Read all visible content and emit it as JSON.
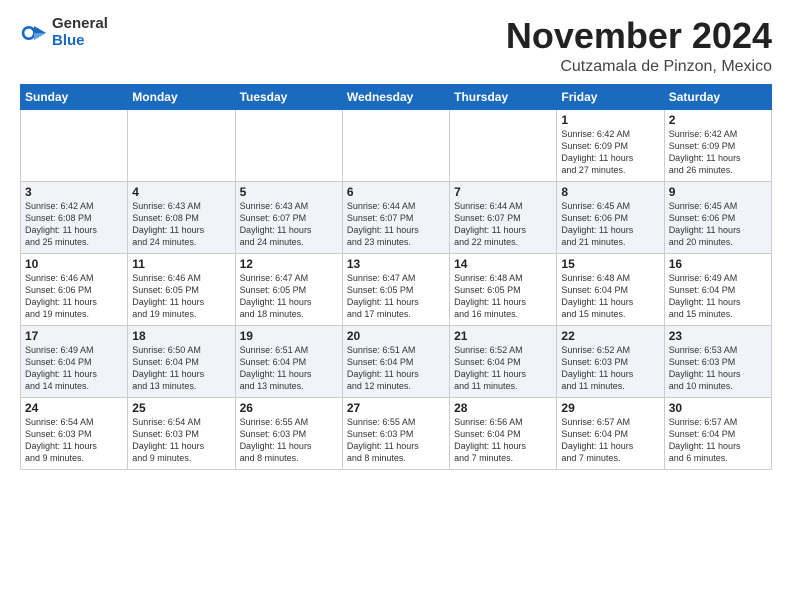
{
  "logo": {
    "general": "General",
    "blue": "Blue"
  },
  "title": "November 2024",
  "location": "Cutzamala de Pinzon, Mexico",
  "headers": [
    "Sunday",
    "Monday",
    "Tuesday",
    "Wednesday",
    "Thursday",
    "Friday",
    "Saturday"
  ],
  "weeks": [
    [
      {
        "day": "",
        "info": ""
      },
      {
        "day": "",
        "info": ""
      },
      {
        "day": "",
        "info": ""
      },
      {
        "day": "",
        "info": ""
      },
      {
        "day": "",
        "info": ""
      },
      {
        "day": "1",
        "info": "Sunrise: 6:42 AM\nSunset: 6:09 PM\nDaylight: 11 hours\nand 27 minutes."
      },
      {
        "day": "2",
        "info": "Sunrise: 6:42 AM\nSunset: 6:09 PM\nDaylight: 11 hours\nand 26 minutes."
      }
    ],
    [
      {
        "day": "3",
        "info": "Sunrise: 6:42 AM\nSunset: 6:08 PM\nDaylight: 11 hours\nand 25 minutes."
      },
      {
        "day": "4",
        "info": "Sunrise: 6:43 AM\nSunset: 6:08 PM\nDaylight: 11 hours\nand 24 minutes."
      },
      {
        "day": "5",
        "info": "Sunrise: 6:43 AM\nSunset: 6:07 PM\nDaylight: 11 hours\nand 24 minutes."
      },
      {
        "day": "6",
        "info": "Sunrise: 6:44 AM\nSunset: 6:07 PM\nDaylight: 11 hours\nand 23 minutes."
      },
      {
        "day": "7",
        "info": "Sunrise: 6:44 AM\nSunset: 6:07 PM\nDaylight: 11 hours\nand 22 minutes."
      },
      {
        "day": "8",
        "info": "Sunrise: 6:45 AM\nSunset: 6:06 PM\nDaylight: 11 hours\nand 21 minutes."
      },
      {
        "day": "9",
        "info": "Sunrise: 6:45 AM\nSunset: 6:06 PM\nDaylight: 11 hours\nand 20 minutes."
      }
    ],
    [
      {
        "day": "10",
        "info": "Sunrise: 6:46 AM\nSunset: 6:06 PM\nDaylight: 11 hours\nand 19 minutes."
      },
      {
        "day": "11",
        "info": "Sunrise: 6:46 AM\nSunset: 6:05 PM\nDaylight: 11 hours\nand 19 minutes."
      },
      {
        "day": "12",
        "info": "Sunrise: 6:47 AM\nSunset: 6:05 PM\nDaylight: 11 hours\nand 18 minutes."
      },
      {
        "day": "13",
        "info": "Sunrise: 6:47 AM\nSunset: 6:05 PM\nDaylight: 11 hours\nand 17 minutes."
      },
      {
        "day": "14",
        "info": "Sunrise: 6:48 AM\nSunset: 6:05 PM\nDaylight: 11 hours\nand 16 minutes."
      },
      {
        "day": "15",
        "info": "Sunrise: 6:48 AM\nSunset: 6:04 PM\nDaylight: 11 hours\nand 15 minutes."
      },
      {
        "day": "16",
        "info": "Sunrise: 6:49 AM\nSunset: 6:04 PM\nDaylight: 11 hours\nand 15 minutes."
      }
    ],
    [
      {
        "day": "17",
        "info": "Sunrise: 6:49 AM\nSunset: 6:04 PM\nDaylight: 11 hours\nand 14 minutes."
      },
      {
        "day": "18",
        "info": "Sunrise: 6:50 AM\nSunset: 6:04 PM\nDaylight: 11 hours\nand 13 minutes."
      },
      {
        "day": "19",
        "info": "Sunrise: 6:51 AM\nSunset: 6:04 PM\nDaylight: 11 hours\nand 13 minutes."
      },
      {
        "day": "20",
        "info": "Sunrise: 6:51 AM\nSunset: 6:04 PM\nDaylight: 11 hours\nand 12 minutes."
      },
      {
        "day": "21",
        "info": "Sunrise: 6:52 AM\nSunset: 6:04 PM\nDaylight: 11 hours\nand 11 minutes."
      },
      {
        "day": "22",
        "info": "Sunrise: 6:52 AM\nSunset: 6:03 PM\nDaylight: 11 hours\nand 11 minutes."
      },
      {
        "day": "23",
        "info": "Sunrise: 6:53 AM\nSunset: 6:03 PM\nDaylight: 11 hours\nand 10 minutes."
      }
    ],
    [
      {
        "day": "24",
        "info": "Sunrise: 6:54 AM\nSunset: 6:03 PM\nDaylight: 11 hours\nand 9 minutes."
      },
      {
        "day": "25",
        "info": "Sunrise: 6:54 AM\nSunset: 6:03 PM\nDaylight: 11 hours\nand 9 minutes."
      },
      {
        "day": "26",
        "info": "Sunrise: 6:55 AM\nSunset: 6:03 PM\nDaylight: 11 hours\nand 8 minutes."
      },
      {
        "day": "27",
        "info": "Sunrise: 6:55 AM\nSunset: 6:03 PM\nDaylight: 11 hours\nand 8 minutes."
      },
      {
        "day": "28",
        "info": "Sunrise: 6:56 AM\nSunset: 6:04 PM\nDaylight: 11 hours\nand 7 minutes."
      },
      {
        "day": "29",
        "info": "Sunrise: 6:57 AM\nSunset: 6:04 PM\nDaylight: 11 hours\nand 7 minutes."
      },
      {
        "day": "30",
        "info": "Sunrise: 6:57 AM\nSunset: 6:04 PM\nDaylight: 11 hours\nand 6 minutes."
      }
    ]
  ]
}
